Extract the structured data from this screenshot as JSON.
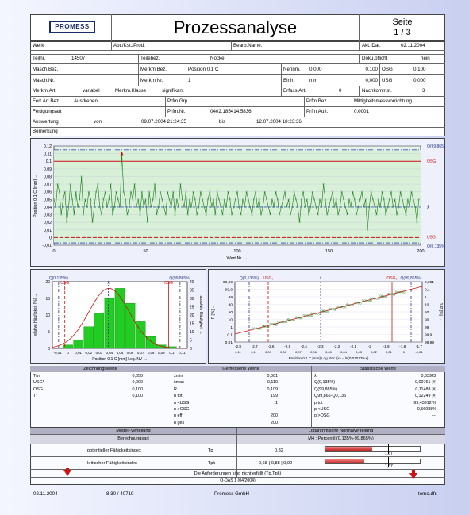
{
  "header": {
    "logo": "PROMESS",
    "title": "Prozessanalyse",
    "page_label": "Seite",
    "page_value": "1 / 3"
  },
  "form": {
    "werk": "Werk",
    "abt": "Abt./Kst./Prod.",
    "bearb": "Bearb.Name.",
    "akt_dat_label": "Akt. Dat.",
    "akt_dat": "02.11.2004",
    "teilnr_label": "Teilnr.",
    "teilnr": "14507",
    "teilebez_label": "Teilebez.",
    "teilebez": "Nocke",
    "doku_label": "Doku.pflicht",
    "doku": "nein",
    "masch_bez": "Masch.Bez.",
    "merkm_bez_label": "Merkm.Bez.",
    "merkm_bez": "Position 0.1 C",
    "nennm_label": "Nennm.",
    "nennm": "0,000",
    "nennm2": "0,100",
    "osg_label": "OSG",
    "osg": "0,100",
    "masch_nr": "Masch.Nr.",
    "merkm_nr_label": "Merkm.Nr.",
    "merkm_nr": "1",
    "einh_label": "Einh.",
    "einh": "mm",
    "einh2": "0,000",
    "usg_label": "USG",
    "usg": "0,000",
    "merkm_art_label": "Merkm.Art",
    "merkm_art": "variabel",
    "merkm_klasse_label": "Merkm.Klasse",
    "merkm_klasse": "signifikant",
    "erfass_label": "Erfass.Art.",
    "erfass": "0",
    "nachkomm_label": "Nachkommst.",
    "nachkomm": "3",
    "fert_art_label": "Fert.Art.Bez.",
    "fert_art": "Ausdrehen",
    "prfm_grp": "Prfm.Grp.",
    "prfm_bez_label": "Prfm.Bez.",
    "prfm_bez": "Mittigkeitsmessvorrichtung",
    "fertigungsart": "Fertigungsart",
    "prfm_nr_label": "Prfm.Nr.",
    "prfm_nr": "0402.185414.5836",
    "prfm_aufl_label": "Prfm.Aufl.",
    "prfm_aufl": "0,0001",
    "auswertung": "Auswertung",
    "von": "von",
    "von_date": "09.07.2004 21:24:35",
    "bis": "bis",
    "bis_date": "12.07.2004 18:23:36",
    "bemerkung": "Bemerkung"
  },
  "run_chart": {
    "ylabel": "Position 0.1 C [mm] →",
    "xlabel": "Wert Nr. →",
    "yticks": [
      "0,12",
      "0,11",
      "0,1",
      "0,09",
      "0,08",
      "0,07",
      "0,06",
      "0,05",
      "0,04",
      "0,03",
      "0,02",
      "0,01",
      "0",
      "-0,01"
    ],
    "xticks": [
      "0",
      "50",
      "100",
      "150",
      "200"
    ],
    "label_q_top": "Q(99,865%)",
    "label_osg": "OSG",
    "label_xbar": "x̄",
    "label_usg": "USG",
    "label_q_bot": "Q(0,135%)"
  },
  "chart_data": [
    {
      "type": "line",
      "title": "",
      "xlabel": "Wert Nr.",
      "ylabel": "Position 0.1 C [mm]",
      "ylim": [
        -0.01,
        0.12
      ],
      "xlim": [
        0,
        200
      ],
      "series": [
        {
          "values": [
            0.05,
            0.04,
            0.07,
            0.06,
            0.03,
            0.05,
            0.06,
            0.02,
            0.04,
            0.07,
            0.05,
            0.03,
            0.06,
            0.04,
            0.05,
            0.08,
            0.03,
            0.05,
            0.04,
            0.06,
            0.05,
            0.02,
            0.04,
            0.06,
            0.07,
            0.04,
            0.03,
            0.05,
            0.06,
            0.04,
            0.05,
            0.07,
            0.03,
            0.04,
            0.06,
            0.05,
            0.04,
            0.11,
            0.06,
            0.05,
            0.03,
            0.04,
            0.06,
            0.05,
            0.07,
            0.04,
            0.05,
            0.03,
            0.06,
            0.04,
            0.05,
            0.02,
            0.06,
            0.04,
            0.05,
            0.07,
            0.03,
            0.04,
            0.06,
            0.05,
            0.04,
            0.03,
            0.06,
            0.05,
            0.04,
            0.06,
            0.03,
            0.05,
            0.04,
            0.07,
            0.05,
            0.04,
            0.06,
            0.03,
            0.05,
            0.04,
            0.06,
            0.05,
            0.03,
            0.04,
            0.06,
            0.05,
            0.04,
            0.03,
            0.05,
            0.06,
            0.04,
            0.05,
            0.03,
            0.06,
            0.05,
            0.04,
            0.03,
            0.05,
            0.04,
            0.06,
            0.05,
            0.03,
            0.04,
            0.05,
            0.06,
            0.04,
            0.03,
            0.05,
            0.04,
            0.06,
            0.05,
            0.04,
            0.03,
            0.05,
            0.06,
            0.04,
            0.05,
            0.03,
            0.04,
            0.06,
            0.05,
            0.04,
            0.03,
            0.05,
            0.04,
            0.06,
            0.05,
            0.03,
            0.04,
            0.05,
            0.06,
            0.04,
            0.05,
            0.03,
            0.04,
            0.06,
            0.05,
            0.04,
            0.02,
            0.05,
            0.06,
            0.04,
            0.05,
            0.03,
            0.04,
            0.06,
            0.05,
            0.04,
            0.03,
            0.05,
            0.04,
            0.07,
            0.05,
            0.03,
            0.04,
            0.05,
            0.06,
            0.04,
            0.05,
            0.03,
            0.04,
            0.06,
            0.05,
            0.04,
            0.03,
            0.05,
            0.04,
            0.06,
            0.05,
            0.03,
            0.04,
            0.05,
            0.06,
            0.04,
            0.05,
            0.01,
            0.04,
            0.06,
            0.05,
            0.04,
            0.03,
            0.05,
            0.04,
            0.06,
            0.05,
            0.03,
            0.04,
            0.05,
            0.06,
            0.04,
            0.05,
            0.03,
            0.04,
            0.06,
            0.05,
            0.04,
            0.03,
            0.05,
            0.04,
            0.06,
            0.05,
            0.04,
            0.02,
            0.05
          ]
        }
      ],
      "lines": {
        "osg": 0.1,
        "usg": 0.0,
        "mean": 0.04,
        "q_upper": 0.115,
        "q_lower": -0.007
      }
    },
    {
      "type": "bar",
      "title": "",
      "xlabel": "Position 0.1 C [mm]  Log. NV →",
      "ylabel": "relative Häufigkeit [%] →",
      "categories": [
        "-0,01",
        "0",
        "0,01",
        "0,02",
        "0,03",
        "0,04",
        "0,05",
        "0,06",
        "0,07",
        "0,08",
        "0,09",
        "0,1",
        "0,11"
      ],
      "values": [
        0,
        2,
        5,
        13,
        21,
        30,
        36,
        27,
        16,
        7,
        2,
        1,
        0
      ],
      "ylim": [
        0,
        40
      ]
    },
    {
      "type": "scatter",
      "title": "",
      "xlabel": "Position 0.1 C [mm]  Log. NV",
      "ylabel": "P [%]",
      "ylim": [
        0.01,
        99.99
      ],
      "xlim": [
        -2.8,
        -1.6
      ]
    }
  ],
  "histogram": {
    "ylabel_left": "relative Häufigkeit [%] →",
    "ylabel_right": "absolute Häufigkeit →",
    "xlabel": "Position 0.1 C [mm]  Log. NV →",
    "yticks_left": [
      "20",
      "15",
      "10",
      "5",
      "0"
    ],
    "yticks_right": [
      "40",
      "35",
      "30",
      "25",
      "20",
      "15",
      "10",
      "5",
      "0"
    ],
    "xticks": [
      "-0,01",
      "0",
      "0,01",
      "0,02",
      "0,03",
      "0,04",
      "0,05",
      "0,06",
      "0,07",
      "0,08",
      "0,09",
      "0,1",
      "0,11"
    ],
    "q_low": "Q(0,135%)",
    "q_high": "Q(99,865%)",
    "usg": "USG",
    "osg": "OSG",
    "xbar": "x̄"
  },
  "prob_plot": {
    "ylabel": "P [%] →",
    "ylabel_right": "1-P [%] →",
    "xlabel_top": "Position 0.1 C [mm]  Log. NV",
    "xlabel_bottom": "Position 0.1 C [mm]  Log. NV    f(x) = ln(0,070379-x)",
    "xlabel_right": "f(x) = x+0,070379 →",
    "yticks": [
      "99,99",
      "99,9",
      "99",
      "90",
      "50",
      "10",
      "1",
      "0,1",
      "0,01"
    ],
    "yticks_right": [
      "0,001",
      "0,1",
      "1",
      "10",
      "50",
      "90",
      "99",
      "99,9",
      "99,99"
    ],
    "xticks_top": [
      "-2,8",
      "-2,6",
      "-2,4",
      "-2,2",
      "-2",
      "-1,8",
      "-1,6"
    ],
    "xticks": [
      "-2,8",
      "-2,7",
      "-2,6",
      "-2,5",
      "-2,4",
      "-2,3",
      "-2,2",
      "-2,1",
      "-2",
      "-1,9",
      "-1,8",
      "-1,7"
    ],
    "xticks_bottom": [
      "0,11",
      "0,1",
      "0,09",
      "0,08",
      "0,07",
      "0,06",
      "0,05",
      "0,04",
      "0,03",
      "0,02",
      "0,01",
      "0",
      "-0,01"
    ],
    "usg": "USG₀",
    "osg": "OSG₀",
    "xbar": "x̄",
    "q_low": "Q(0,135%)",
    "q_high": "Q(99,865%)"
  },
  "stats": {
    "col1_title": "Zeichnungswerte",
    "col2_title": "Gemessene Werte",
    "col3_title": "Statistische Werte",
    "col1": [
      {
        "label": "Tm",
        "value": "0,050"
      },
      {
        "label": "USG*",
        "value": "0,000"
      },
      {
        "label": "OSG",
        "value": "0,100"
      },
      {
        "label": "T*",
        "value": "0,100"
      }
    ],
    "col2": [
      {
        "label": "x̄min",
        "value": "0,001"
      },
      {
        "label": "x̄max",
        "value": "0,110"
      },
      {
        "label": "R",
        "value": "0,109"
      },
      {
        "label": "n tot",
        "value": "199"
      },
      {
        "label": "n <USG",
        "value": "1"
      },
      {
        "label": "n >OSG",
        "value": "---"
      },
      {
        "label": "n eff",
        "value": "200"
      },
      {
        "label": "n ges",
        "value": "200"
      }
    ],
    "col3": [
      {
        "label": "x̄",
        "value": "0,03922"
      },
      {
        "label": "Q(0,135%)",
        "value": "-0,00761 [#]"
      },
      {
        "label": "Q(99,865%)",
        "value": "0,11488 [#]"
      },
      {
        "label": "Q99,865-Q0,135",
        "value": "0,12249 [#]"
      },
      {
        "label": "p tot",
        "value": "99,43912 %"
      },
      {
        "label": "p <USG",
        "value": "0,56088%"
      },
      {
        "label": "p >OSG",
        "value": "---"
      }
    ]
  },
  "bottom": {
    "modell_verteilung": "Modell-Verteilung",
    "log_normal": "Logarithmische Normalverteilung",
    "berechnungsart": "Berechnungsart",
    "m4_percentil": "M4 ; Percentil (0,135%-99,865%)",
    "pot_label": "potentieller Fähigkeitsindex",
    "pot_sym": "Tp",
    "pot_val": "0,82",
    "pot_ref": "1,67",
    "krit_label": "kritischer Fähigkeitsindex",
    "krit_sym": "Tpk",
    "krit_val": "0,68 ( 0,88 | 0,92",
    "krit_ref": "1,67",
    "requirement": "Die Anforderungen sind nicht erfüllt (Tp,Tpk)",
    "qdas": "Q-DAS 1 (04/2004)"
  },
  "footer": {
    "date": "02.11.2004",
    "version": "8.30 / 40719",
    "company": "Promess GmbH",
    "file": "temo.dfs"
  },
  "colors": {
    "accent_red": "#d01010",
    "line_green": "#1a7a1a",
    "bar_green": "#22cc22",
    "band_blue": "#4455cc"
  }
}
